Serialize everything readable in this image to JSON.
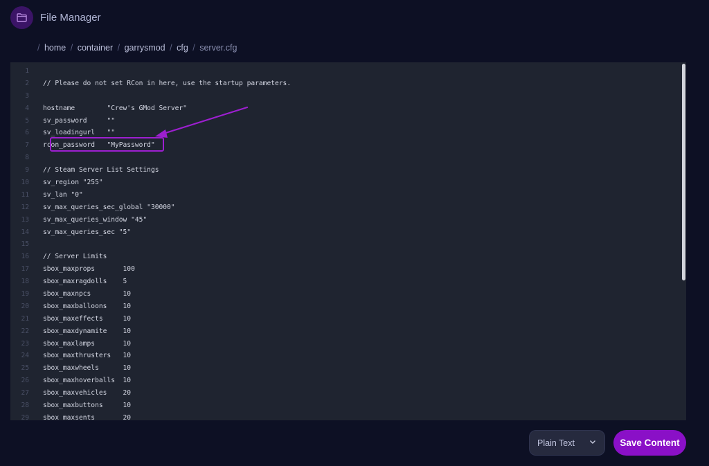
{
  "header": {
    "title": "File Manager",
    "icon": "folder-icon"
  },
  "breadcrumb": {
    "segments": [
      "home",
      "container",
      "garrysmod",
      "cfg",
      "server.cfg"
    ]
  },
  "editor": {
    "lines": [
      "",
      "// Please do not set RCon in here, use the startup parameters.",
      "",
      "hostname        \"Crew's GMod Server\"",
      "sv_password     \"\"",
      "sv_loadingurl   \"\"",
      "rcon_password   \"MyPassword\"",
      "",
      "// Steam Server List Settings",
      "sv_region \"255\"",
      "sv_lan \"0\"",
      "sv_max_queries_sec_global \"30000\"",
      "sv_max_queries_window \"45\"",
      "sv_max_queries_sec \"5\"",
      "",
      "// Server Limits",
      "sbox_maxprops       100",
      "sbox_maxragdolls    5",
      "sbox_maxnpcs        10",
      "sbox_maxballoons    10",
      "sbox_maxeffects     10",
      "sbox_maxdynamite    10",
      "sbox_maxlamps       10",
      "sbox_maxthrusters   10",
      "sbox_maxwheels      10",
      "sbox_maxhoverballs  10",
      "sbox_maxvehicles    20",
      "sbox_maxbuttons     10",
      "sbox_maxsents       20"
    ]
  },
  "footer": {
    "mode_select": {
      "value": "Plain Text"
    },
    "save_label": "Save Content"
  },
  "colors": {
    "accent": "#8a10c7",
    "highlight": "#9d1fd0",
    "background": "#0d1024",
    "editor_bg": "#1f2430"
  }
}
